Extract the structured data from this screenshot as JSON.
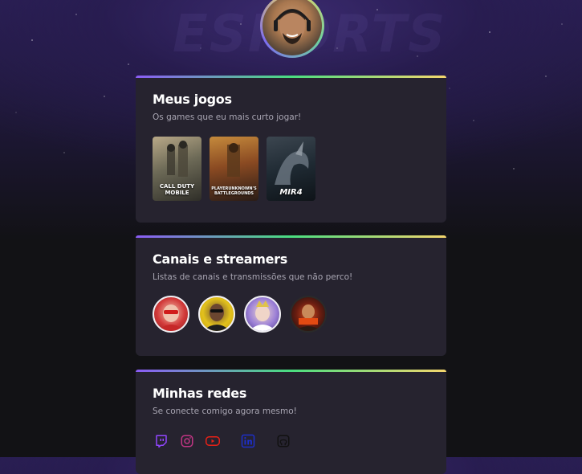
{
  "background": {
    "logo_text": "ESPORTS"
  },
  "profile": {
    "avatar_alt": "Profile photo"
  },
  "cards": {
    "games": {
      "title": "Meus jogos",
      "subtitle": "Os games que eu mais curto jogar!",
      "items": [
        {
          "name": "CALL DUTY MOBILE",
          "icon": "call-of-duty-mobile-cover"
        },
        {
          "name": "PLAYERUNKNOWN'S BATTLEGROUNDS",
          "icon": "pubg-cover"
        },
        {
          "name": "MIR4",
          "icon": "mir4-cover"
        }
      ]
    },
    "streamers": {
      "title": "Canais e streamers",
      "subtitle": "Listas de canais e transmissões que não perco!",
      "items": [
        {
          "icon": "streamer-avatar-1"
        },
        {
          "icon": "streamer-avatar-2"
        },
        {
          "icon": "streamer-avatar-3"
        },
        {
          "icon": "streamer-avatar-4"
        }
      ]
    },
    "socials": {
      "title": "Minhas redes",
      "subtitle": "Se conecte comigo agora mesmo!",
      "items": [
        {
          "icon": "twitch-icon",
          "color": "#9146ff"
        },
        {
          "icon": "instagram-icon",
          "color": "#c13584"
        },
        {
          "icon": "youtube-icon",
          "color": "#e62117"
        },
        {
          "icon": "linkedin-icon",
          "color": "#1d2fcc"
        },
        {
          "icon": "github-icon",
          "color": "#111111"
        }
      ]
    }
  },
  "colors": {
    "card_bg": "#26232f",
    "accent_gradient": [
      "#8b5cf6",
      "#4ade80",
      "#f5d76e"
    ],
    "subtitle": "#a8a5b2"
  }
}
